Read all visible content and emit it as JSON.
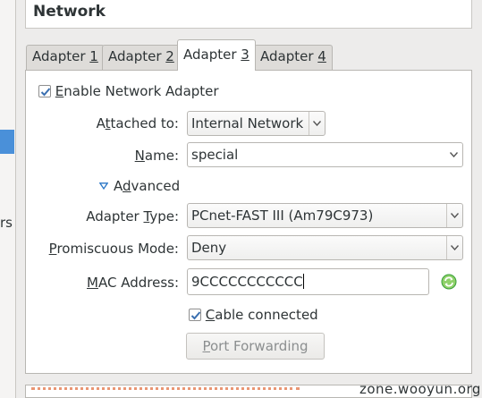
{
  "window": {
    "section_title": "Network",
    "left_fragment": "rs"
  },
  "tabs": [
    {
      "label": "Adapter ",
      "key": "1"
    },
    {
      "label": "Adapter ",
      "key": "2"
    },
    {
      "label": "Adapter ",
      "key": "3"
    },
    {
      "label": "Adapter ",
      "key": "4"
    }
  ],
  "active_tab": "Adapter 3",
  "enable_adapter": {
    "key": "E",
    "label": "nable Network Adapter",
    "checked": true
  },
  "attached_to": {
    "label_pre": "A",
    "key": "t",
    "label_post": "tached to:",
    "value": "Internal Network"
  },
  "name": {
    "key": "N",
    "label_post": "ame:",
    "value": "special"
  },
  "advanced": {
    "label_pre": "A",
    "key": "d",
    "label_post": "vanced",
    "expanded": true
  },
  "adapter_type": {
    "label_pre": "Adapter ",
    "key": "T",
    "label_post": "ype:",
    "value": "PCnet-FAST III (Am79C973)"
  },
  "promiscuous_mode": {
    "key": "P",
    "label_post": "romiscuous Mode:",
    "value": "Deny"
  },
  "mac_address": {
    "key": "M",
    "label_post": "AC Address:",
    "value": "9CCCCCCCCCCC"
  },
  "cable_connected": {
    "key": "C",
    "label_post": "able connected",
    "checked": true
  },
  "port_forwarding": {
    "key": "P",
    "label_post": "ort Forwarding"
  },
  "watermark": "zone.wooyun.org",
  "colors": {
    "accent": "#4a90d9",
    "refresh_icon": "#3aa03a",
    "checkmark": "#3a6fb0"
  }
}
